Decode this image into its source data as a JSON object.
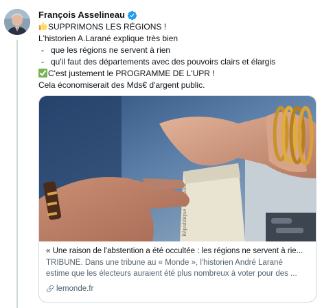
{
  "author": {
    "name": "François Asselineau",
    "verified": true,
    "avatar_icon": "profile-photo"
  },
  "tweet": {
    "line1": "SUPPRIMONS LES RÉGIONS !",
    "line1_emoji": "thumbs-up-emoji",
    "line2": "L'historien A.Larané explique très bien",
    "bullet_char": "-",
    "bullet1": "que les régions ne servent à rien",
    "bullet2": "qu'il faut des départements avec des pouvoirs clairs et élargis",
    "line5": "C'est justement le PROGRAMME DE L'UPR !",
    "line5_emoji": "check-mark-emoji",
    "line6": "Cela économiserait des Mds€ d'argent public."
  },
  "card": {
    "image_text": "République Française",
    "title": "« Une raison de l'abstention a été occultée : les régions ne servent à rie...",
    "description_line1": "TRIBUNE. Dans une tribune au « Monde », l'historien André Larané",
    "description_line2": "estime que les électeurs auraient été plus nombreux à voter pour des ...",
    "domain": "lemonde.fr",
    "domain_icon": "link-icon"
  },
  "colors": {
    "verified_blue": "#1d9bf0",
    "secondary_text": "#536471",
    "border": "#cfd9de",
    "check_green": "#77b255",
    "thumb_yellow": "#ffcc4d"
  }
}
